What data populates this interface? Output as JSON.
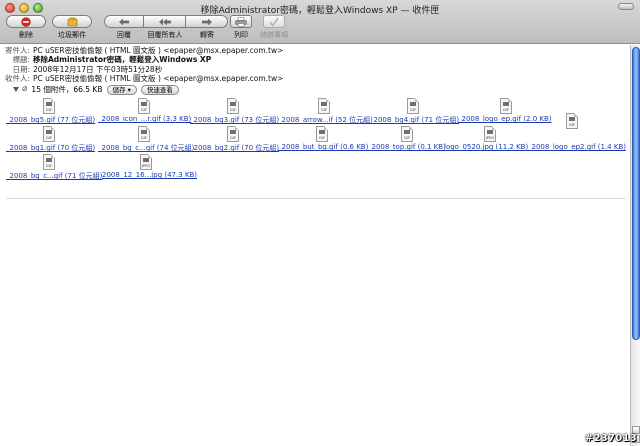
{
  "window": {
    "title": "移除Administrator密碼，輕鬆登入Windows XP — 收件匣"
  },
  "toolbar": {
    "delete": {
      "label": "刪除",
      "icon": "no-sign-icon"
    },
    "junk": {
      "label": "垃圾郵件",
      "icon": "junk-bin-icon"
    },
    "reply": {
      "label": "回覆",
      "icon": "arrow-left-icon"
    },
    "reply_all": {
      "label": "回覆所有人",
      "icon": "double-arrow-left-icon"
    },
    "forward": {
      "label": "轉寄",
      "icon": "arrow-right-icon"
    },
    "print": {
      "label": "列印",
      "icon": "printer-icon"
    },
    "todo": {
      "label": "待辦事項",
      "icon": "checkmark-icon"
    }
  },
  "header": {
    "from_label": "寄件人:",
    "from_value": "PC uSER密技偷偷報 ( HTML 圖文版 ) <epaper@msx.epaper.com.tw>",
    "subject_label": "標題:",
    "subject_value": "移除Administrator密碼，輕鬆登入Windows XP",
    "date_label": "日期:",
    "date_value": "2008年12月17日 下午03時51分28秒",
    "to_label": "收件人:",
    "to_value": "PC uSER密技偷偷報 ( HTML 圖文版 ) <epaper@msx.epaper.com.tw>",
    "attachments_summary": "15 個附件，66.5 KB",
    "save_button": "儲存 ▾",
    "quicklook_button": "快速查看"
  },
  "attachments": {
    "row1": [
      {
        "type": "GIF",
        "name": "_2008_bg5.gif (77 位元組)"
      },
      {
        "type": "GIF",
        "name": "_2008_icon_...r.gif (3.3 KB)"
      },
      {
        "type": "GIF",
        "name": "_2008_bg3.gif (73 位元組)"
      },
      {
        "type": "GIF",
        "name": "_2008_arrow...if (52 位元組)"
      },
      {
        "type": "GIF",
        "name": "_2008_bg4.gif (71 位元組)"
      },
      {
        "type": "GIF",
        "name": "_2008_logo_ep.gif (2.0 KB)"
      }
    ],
    "row2": [
      {
        "type": "GIF",
        "name": "_2008_bg1.gif (70 位元組)"
      },
      {
        "type": "GIF",
        "name": "_2008_bg_c...gif (74 位元組)"
      },
      {
        "type": "GIF",
        "name": "_2008_bg2.gif (70 位元組)"
      },
      {
        "type": "GIF",
        "name": "_2008_but_bg.gif (0.6 KB)"
      },
      {
        "type": "GIF",
        "name": "_2008_top.gif (0.1 KB)"
      },
      {
        "type": "JPEG",
        "name": "logo_0520.jpg (11.2 KB)"
      },
      {
        "type": "GIF",
        "name": "_2008_logo_ep2.gif (1.4 KB)"
      }
    ],
    "row3": [
      {
        "type": "GIF",
        "name": "_2008_bg_c...gif (71 位元組)"
      },
      {
        "type": "JPEG",
        "name": "2008_12_16...jpg (47.3 KB)"
      }
    ]
  },
  "watermark": "#237013"
}
